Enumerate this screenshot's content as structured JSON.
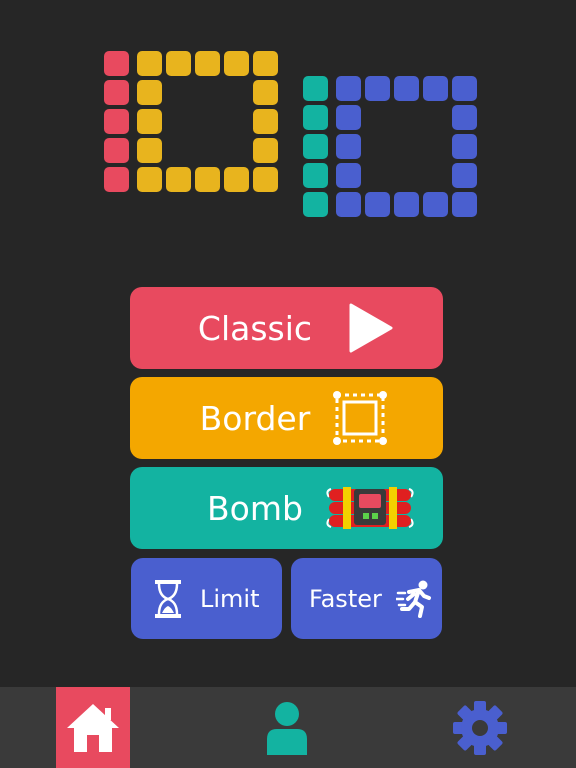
{
  "logo": {
    "text": "10 10",
    "colors": {
      "red": "#E84A5F",
      "yellow": "#E8B41E",
      "teal": "#13B3A1",
      "blue": "#4A5FCF"
    }
  },
  "modes": {
    "classic": {
      "label": "Classic",
      "color": "#E84A5F",
      "icon": "play-icon"
    },
    "border": {
      "label": "Border",
      "color": "#F4A700",
      "icon": "dashed-square-icon"
    },
    "bomb": {
      "label": "Bomb",
      "color": "#13B3A1",
      "icon": "dynamite-icon"
    },
    "limit": {
      "label": "Limit",
      "color": "#4A5FCF",
      "icon": "hourglass-icon"
    },
    "faster": {
      "label": "Faster",
      "color": "#4A5FCF",
      "icon": "running-man-icon"
    }
  },
  "bottom_nav": {
    "items": [
      {
        "name": "home",
        "icon": "home-icon",
        "active": true,
        "color": "#E84A5F"
      },
      {
        "name": "profile",
        "icon": "user-icon",
        "active": false,
        "color": "#13B3A1"
      },
      {
        "name": "settings",
        "icon": "gear-icon",
        "active": false,
        "color": "#4A5FCF"
      }
    ]
  }
}
